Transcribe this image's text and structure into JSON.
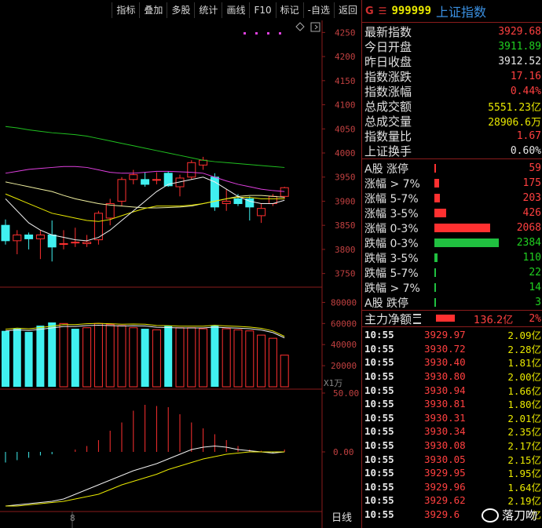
{
  "toolbar": {
    "items": [
      "指标",
      "叠加",
      "多股",
      "统计",
      "画线",
      "F10",
      "标记",
      "-自选",
      "返回"
    ]
  },
  "chart_data": {
    "type": "candlestick",
    "price_axis": [
      "4250",
      "4200",
      "4150",
      "4100",
      "4050",
      "4000",
      "3950",
      "3900",
      "3850",
      "3800",
      "3750"
    ],
    "volume_axis": [
      "80000",
      "60000",
      "40000",
      "20000"
    ],
    "volume_unit": "X1万",
    "macd_axis": [
      "50.00",
      "0.00"
    ],
    "date_marker": "8",
    "period_label": "日线",
    "candles": [
      {
        "o": 3850,
        "h": 3862,
        "l": 3810,
        "c": 3818
      },
      {
        "o": 3818,
        "h": 3840,
        "l": 3790,
        "c": 3830
      },
      {
        "o": 3830,
        "h": 3835,
        "l": 3800,
        "c": 3822
      },
      {
        "o": 3822,
        "h": 3840,
        "l": 3780,
        "c": 3830
      },
      {
        "o": 3830,
        "h": 3860,
        "l": 3775,
        "c": 3805
      },
      {
        "o": 3812,
        "h": 3840,
        "l": 3800,
        "c": 3812
      },
      {
        "o": 3815,
        "h": 3845,
        "l": 3805,
        "c": 3815
      },
      {
        "o": 3812,
        "h": 3830,
        "l": 3805,
        "c": 3815
      },
      {
        "o": 3820,
        "h": 3880,
        "l": 3810,
        "c": 3875
      },
      {
        "o": 3865,
        "h": 3905,
        "l": 3850,
        "c": 3895
      },
      {
        "o": 3900,
        "h": 3950,
        "l": 3890,
        "c": 3945
      },
      {
        "o": 3945,
        "h": 3965,
        "l": 3935,
        "c": 3955
      },
      {
        "o": 3945,
        "h": 3960,
        "l": 3930,
        "c": 3935
      },
      {
        "o": 3945,
        "h": 3960,
        "l": 3935,
        "c": 3945
      },
      {
        "o": 3958,
        "h": 3962,
        "l": 3930,
        "c": 3932
      },
      {
        "o": 3930,
        "h": 3955,
        "l": 3910,
        "c": 3948
      },
      {
        "o": 3950,
        "h": 3985,
        "l": 3945,
        "c": 3980
      },
      {
        "o": 3975,
        "h": 3992,
        "l": 3965,
        "c": 3985
      },
      {
        "o": 3950,
        "h": 3958,
        "l": 3880,
        "c": 3888
      },
      {
        "o": 3895,
        "h": 3925,
        "l": 3880,
        "c": 3900
      },
      {
        "o": 3905,
        "h": 3915,
        "l": 3890,
        "c": 3895
      },
      {
        "o": 3905,
        "h": 3910,
        "l": 3860,
        "c": 3888
      },
      {
        "o": 3870,
        "h": 3895,
        "l": 3855,
        "c": 3885
      },
      {
        "o": 3895,
        "h": 3915,
        "l": 3890,
        "c": 3910
      },
      {
        "o": 3910,
        "h": 3930,
        "l": 3905,
        "c": 3928
      }
    ],
    "volumes": [
      {
        "v": 53000,
        "up": false
      },
      {
        "v": 55000,
        "up": false
      },
      {
        "v": 52000,
        "up": false
      },
      {
        "v": 58000,
        "up": false
      },
      {
        "v": 61000,
        "up": false
      },
      {
        "v": 60000,
        "up": true
      },
      {
        "v": 55000,
        "up": false
      },
      {
        "v": 56000,
        "up": true
      },
      {
        "v": 60000,
        "up": true
      },
      {
        "v": 59000,
        "up": true
      },
      {
        "v": 58000,
        "up": true
      },
      {
        "v": 56000,
        "up": true
      },
      {
        "v": 55000,
        "up": false
      },
      {
        "v": 54000,
        "up": true
      },
      {
        "v": 58000,
        "up": false
      },
      {
        "v": 56000,
        "up": true
      },
      {
        "v": 56000,
        "up": true
      },
      {
        "v": 55000,
        "up": true
      },
      {
        "v": 58000,
        "up": false
      },
      {
        "v": 55000,
        "up": true
      },
      {
        "v": 54000,
        "up": true
      },
      {
        "v": 53000,
        "up": true
      },
      {
        "v": 49000,
        "up": true
      },
      {
        "v": 46000,
        "up": true
      },
      {
        "v": 30000,
        "up": true
      }
    ],
    "macd": [
      -9,
      -7,
      -5,
      -3,
      -2,
      0,
      2,
      5,
      10,
      18,
      25,
      35,
      40,
      39,
      38,
      32,
      25,
      20,
      15,
      10,
      5,
      2,
      1,
      -1,
      2
    ],
    "macd_dif": [
      -46,
      -45,
      -44,
      -43,
      -42,
      -40,
      -36,
      -32,
      -28,
      -24,
      -20,
      -16,
      -13,
      -10,
      -6,
      -2,
      2,
      4,
      5,
      4,
      2,
      1,
      0,
      -1,
      0
    ],
    "macd_dea": [
      -46,
      -46,
      -45,
      -44,
      -43,
      -42,
      -40,
      -38,
      -36,
      -32,
      -28,
      -25,
      -22,
      -19,
      -15,
      -12,
      -9,
      -6,
      -4,
      -2,
      -1,
      0,
      0,
      0,
      0
    ],
    "ma5": [
      3905,
      3880,
      3855,
      3840,
      3830,
      3825,
      3820,
      3818,
      3825,
      3840,
      3860,
      3880,
      3900,
      3920,
      3935,
      3940,
      3945,
      3950,
      3940,
      3925,
      3910,
      3900,
      3895,
      3895,
      3902
    ],
    "ma10": [
      3915,
      3905,
      3895,
      3885,
      3875,
      3870,
      3865,
      3860,
      3858,
      3862,
      3870,
      3878,
      3885,
      3890,
      3890,
      3890,
      3892,
      3895,
      3900,
      3905,
      3908,
      3908,
      3905,
      3905,
      3905
    ],
    "ma20": [
      3940,
      3935,
      3930,
      3925,
      3920,
      3912,
      3905,
      3900,
      3895,
      3892,
      3890,
      3888,
      3886,
      3886,
      3887,
      3888,
      3890,
      3895,
      3900,
      3905,
      3910,
      3912,
      3912,
      3910,
      3908
    ],
    "ma60": [
      4055,
      4052,
      4048,
      4045,
      4042,
      4040,
      4038,
      4035,
      4030,
      4025,
      4020,
      4015,
      4010,
      4005,
      4000,
      3995,
      3990,
      3985,
      3982,
      3980,
      3978,
      3976,
      3974,
      3972,
      3970
    ],
    "ma_purple": [
      3958,
      3962,
      3966,
      3968,
      3970,
      3972,
      3972,
      3970,
      3965,
      3960,
      3958,
      3958,
      3960,
      3962,
      3962,
      3961,
      3960,
      3958,
      3950,
      3942,
      3935,
      3930,
      3925,
      3922,
      3920
    ]
  },
  "panel": {
    "header": {
      "g": "G",
      "menu": "☰",
      "code": "999999",
      "name": "上证指数"
    },
    "stats": [
      {
        "label": "最新指数",
        "value": "3929.68",
        "color": "red"
      },
      {
        "label": "今日开盘",
        "value": "3911.89",
        "color": "green"
      },
      {
        "label": "昨日收盘",
        "value": "3912.52",
        "color": "white"
      },
      {
        "label": "指数涨跌",
        "value": "17.16",
        "color": "red"
      },
      {
        "label": "指数涨幅",
        "value": "0.44%",
        "color": "red"
      },
      {
        "label": "总成交额",
        "value": "5551.23亿",
        "color": "yellow"
      },
      {
        "label": "总成交量",
        "value": "28906.6万",
        "color": "yellow"
      },
      {
        "label": "指数量比",
        "value": "1.67",
        "color": "red"
      },
      {
        "label": "上证换手",
        "value": "0.60%",
        "color": "white"
      }
    ],
    "breadth": [
      {
        "label": "A股 涨停",
        "value": "59",
        "color": "red",
        "count": 59
      },
      {
        "label": "涨幅 > 7%",
        "value": "175",
        "color": "red",
        "count": 175
      },
      {
        "label": "涨幅 5-7%",
        "value": "203",
        "color": "red",
        "count": 203
      },
      {
        "label": "涨幅 3-5%",
        "value": "426",
        "color": "red",
        "count": 426
      },
      {
        "label": "涨幅 0-3%",
        "value": "2068",
        "color": "red",
        "count": 2068
      },
      {
        "label": "跌幅 0-3%",
        "value": "2384",
        "color": "green",
        "count": 2384
      },
      {
        "label": "跌幅 3-5%",
        "value": "110",
        "color": "green",
        "count": 110
      },
      {
        "label": "跌幅 5-7%",
        "value": "22",
        "color": "green",
        "count": 22
      },
      {
        "label": "跌幅 > 7%",
        "value": "14",
        "color": "green",
        "count": 14
      },
      {
        "label": "A股 跌停",
        "value": "3",
        "color": "green",
        "count": 3
      }
    ],
    "flow": {
      "label": "主力净额",
      "amount": "136.2亿",
      "pct": "2%",
      "pct_value": 2
    },
    "ticks": [
      {
        "time": "10:55",
        "price": "3929.97",
        "vol": "2.09亿"
      },
      {
        "time": "10:55",
        "price": "3930.72",
        "vol": "2.28亿"
      },
      {
        "time": "10:55",
        "price": "3930.40",
        "vol": "1.81亿"
      },
      {
        "time": "10:55",
        "price": "3930.80",
        "vol": "2.00亿"
      },
      {
        "time": "10:55",
        "price": "3930.94",
        "vol": "1.66亿"
      },
      {
        "time": "10:55",
        "price": "3930.81",
        "vol": "1.80亿"
      },
      {
        "time": "10:55",
        "price": "3930.31",
        "vol": "2.01亿"
      },
      {
        "time": "10:55",
        "price": "3930.34",
        "vol": "2.35亿"
      },
      {
        "time": "10:55",
        "price": "3930.08",
        "vol": "2.17亿"
      },
      {
        "time": "10:55",
        "price": "3930.05",
        "vol": "2.15亿"
      },
      {
        "time": "10:55",
        "price": "3929.95",
        "vol": "1.95亿"
      },
      {
        "time": "10:55",
        "price": "3929.96",
        "vol": "1.64亿"
      },
      {
        "time": "10:55",
        "price": "3929.62",
        "vol": "2.19亿"
      },
      {
        "time": "10:55",
        "price": "3929.6",
        "vol": "亿"
      }
    ]
  },
  "watermark": {
    "text": "落刀吻"
  },
  "colors": {
    "up": "#ff3030",
    "down": "#40f0f0",
    "ma5": "#f0f0f0",
    "ma10": "#e8e800",
    "ma20": "#e040e0",
    "ma60": "#20c020",
    "grid": "#8a1c1c"
  }
}
